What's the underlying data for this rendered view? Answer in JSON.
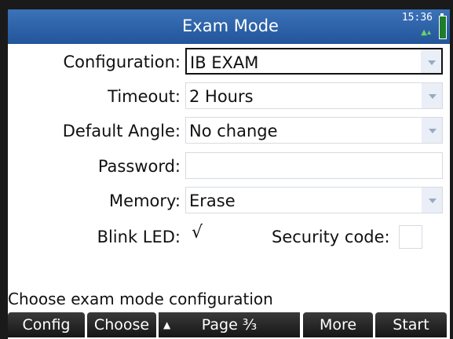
{
  "window": {
    "title": "Exam Mode",
    "clock": "15:36"
  },
  "form": {
    "configuration": {
      "label": "Configuration:",
      "value": "IB EXAM"
    },
    "timeout": {
      "label": "Timeout:",
      "value": "2 Hours"
    },
    "default_angle": {
      "label": "Default Angle:",
      "value": "No change"
    },
    "password": {
      "label": "Password:",
      "value": ""
    },
    "memory": {
      "label": "Memory:",
      "value": "Erase"
    },
    "blink_led": {
      "label": "Blink LED:",
      "checked_glyph": "√"
    },
    "security_code": {
      "label": "Security code:",
      "value": ""
    }
  },
  "help_text": "Choose exam mode configuration",
  "menu": {
    "config": "Config",
    "choose": "Choose",
    "page": "Page ³⁄₃",
    "more": "More",
    "start": "Start"
  },
  "colors": {
    "title_bar": "#23559a",
    "menu_bar": "#161616",
    "dropdown_tab": "#e9eef7"
  },
  "icons": [
    "dropdown-arrow-icon",
    "battery-icon",
    "signal-icon",
    "sort-icon"
  ]
}
